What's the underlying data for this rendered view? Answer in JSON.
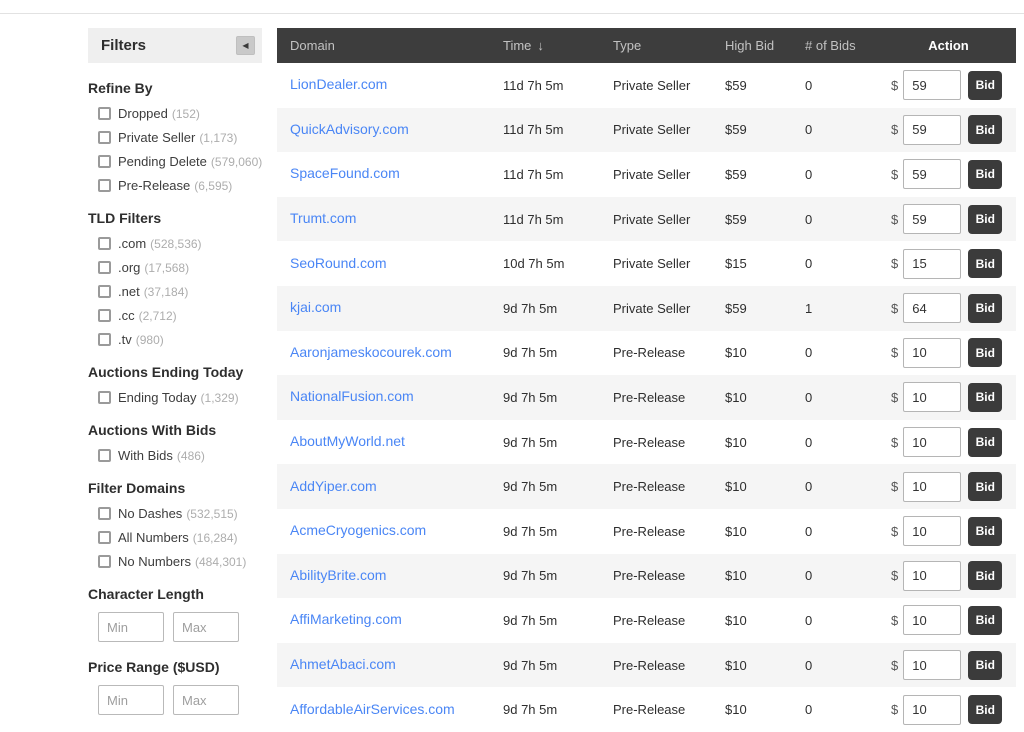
{
  "icons": {
    "collapse": "◀",
    "sort_desc": "↓"
  },
  "colors": {
    "link_blue": "#4a86f5",
    "header_bg": "#3d3d3d",
    "row_alt": "#f5f5f5",
    "bid_button_bg": "#3b3b3b",
    "filters_header_bg": "#efefef"
  },
  "sidebar": {
    "title": "Filters",
    "sections": [
      {
        "title": "Refine By",
        "items": [
          {
            "label": "Dropped",
            "count": "(152)"
          },
          {
            "label": "Private Seller",
            "count": "(1,173)"
          },
          {
            "label": "Pending Delete",
            "count": "(579,060)"
          },
          {
            "label": "Pre-Release",
            "count": "(6,595)"
          }
        ]
      },
      {
        "title": "TLD Filters",
        "items": [
          {
            "label": ".com",
            "count": "(528,536)"
          },
          {
            "label": ".org",
            "count": "(17,568)"
          },
          {
            "label": ".net",
            "count": "(37,184)"
          },
          {
            "label": ".cc",
            "count": "(2,712)"
          },
          {
            "label": ".tv",
            "count": "(980)"
          }
        ]
      },
      {
        "title": "Auctions Ending Today",
        "items": [
          {
            "label": "Ending Today",
            "count": "(1,329)"
          }
        ]
      },
      {
        "title": "Auctions With Bids",
        "items": [
          {
            "label": "With Bids",
            "count": "(486)"
          }
        ]
      },
      {
        "title": "Filter Domains",
        "items": [
          {
            "label": "No Dashes",
            "count": "(532,515)"
          },
          {
            "label": "All Numbers",
            "count": "(16,284)"
          },
          {
            "label": "No Numbers",
            "count": "(484,301)"
          }
        ]
      },
      {
        "title": "Character Length",
        "range": {
          "min": "Min",
          "max": "Max"
        }
      },
      {
        "title": "Price Range ($USD)",
        "range": {
          "min": "Min",
          "max": "Max"
        }
      }
    ]
  },
  "table": {
    "columns": [
      "Domain",
      "Time",
      "Type",
      "High Bid",
      "# of Bids",
      "Action"
    ],
    "currency": "$",
    "bid_button_label": "Bid",
    "rows": [
      {
        "domain": "LionDealer.com",
        "time": "11d 7h 5m",
        "type": "Private Seller",
        "high_bid": "$59",
        "bids": "0",
        "bid_value": "59"
      },
      {
        "domain": "QuickAdvisory.com",
        "time": "11d 7h 5m",
        "type": "Private Seller",
        "high_bid": "$59",
        "bids": "0",
        "bid_value": "59"
      },
      {
        "domain": "SpaceFound.com",
        "time": "11d 7h 5m",
        "type": "Private Seller",
        "high_bid": "$59",
        "bids": "0",
        "bid_value": "59"
      },
      {
        "domain": "Trumt.com",
        "time": "11d 7h 5m",
        "type": "Private Seller",
        "high_bid": "$59",
        "bids": "0",
        "bid_value": "59"
      },
      {
        "domain": "SeoRound.com",
        "time": "10d 7h 5m",
        "type": "Private Seller",
        "high_bid": "$15",
        "bids": "0",
        "bid_value": "15"
      },
      {
        "domain": "kjai.com",
        "time": "9d 7h 5m",
        "type": "Private Seller",
        "high_bid": "$59",
        "bids": "1",
        "bid_value": "64"
      },
      {
        "domain": "Aaronjameskocourek.com",
        "time": "9d 7h 5m",
        "type": "Pre-Release",
        "high_bid": "$10",
        "bids": "0",
        "bid_value": "10"
      },
      {
        "domain": "NationalFusion.com",
        "time": "9d 7h 5m",
        "type": "Pre-Release",
        "high_bid": "$10",
        "bids": "0",
        "bid_value": "10"
      },
      {
        "domain": "AboutMyWorld.net",
        "time": "9d 7h 5m",
        "type": "Pre-Release",
        "high_bid": "$10",
        "bids": "0",
        "bid_value": "10"
      },
      {
        "domain": "AddYiper.com",
        "time": "9d 7h 5m",
        "type": "Pre-Release",
        "high_bid": "$10",
        "bids": "0",
        "bid_value": "10"
      },
      {
        "domain": "AcmeCryogenics.com",
        "time": "9d 7h 5m",
        "type": "Pre-Release",
        "high_bid": "$10",
        "bids": "0",
        "bid_value": "10"
      },
      {
        "domain": "AbilityBrite.com",
        "time": "9d 7h 5m",
        "type": "Pre-Release",
        "high_bid": "$10",
        "bids": "0",
        "bid_value": "10"
      },
      {
        "domain": "AffiMarketing.com",
        "time": "9d 7h 5m",
        "type": "Pre-Release",
        "high_bid": "$10",
        "bids": "0",
        "bid_value": "10"
      },
      {
        "domain": "AhmetAbaci.com",
        "time": "9d 7h 5m",
        "type": "Pre-Release",
        "high_bid": "$10",
        "bids": "0",
        "bid_value": "10"
      },
      {
        "domain": "AffordableAirServices.com",
        "time": "9d 7h 5m",
        "type": "Pre-Release",
        "high_bid": "$10",
        "bids": "0",
        "bid_value": "10"
      }
    ]
  }
}
